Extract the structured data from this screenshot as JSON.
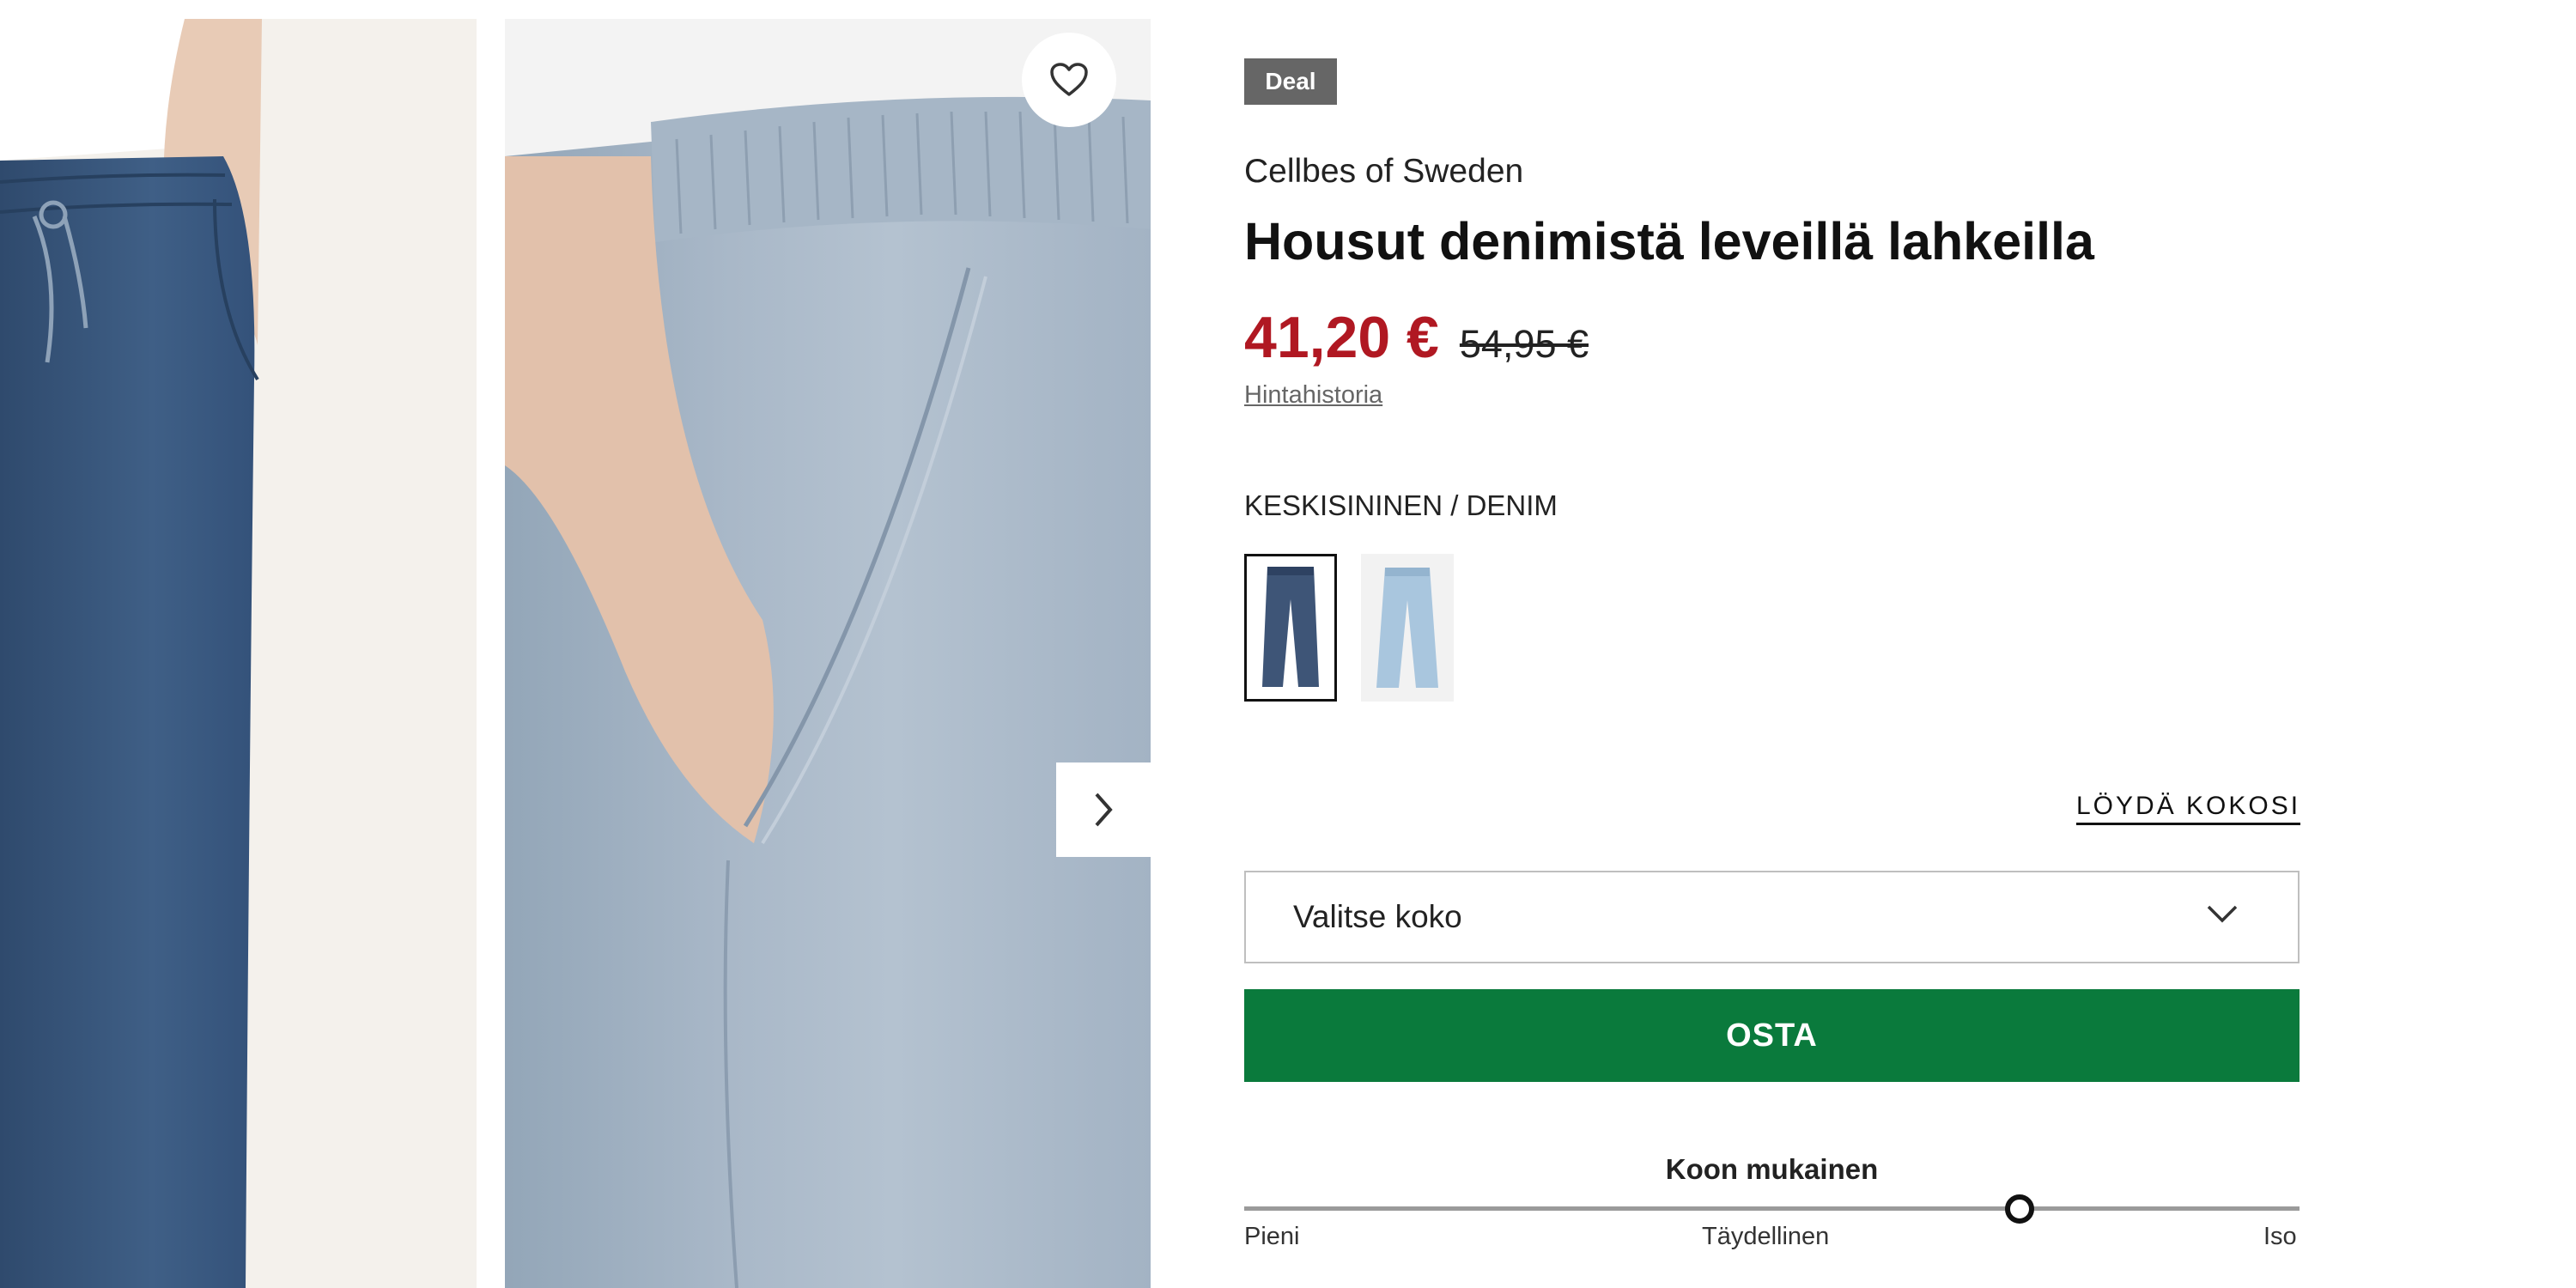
{
  "product": {
    "badge": "Deal",
    "brand": "Cellbes of Sweden",
    "title": "Housut denimistä leveillä lahkeilla",
    "price_current": "41,20 €",
    "price_original": "54,95 €",
    "price_history_link": "Hintahistoria",
    "price_color": "#b01822"
  },
  "gallery": {
    "favorite_icon": "heart-icon",
    "next_icon": "chevron-right-icon"
  },
  "color": {
    "selected_label": "KESKISININEN / DENIM",
    "swatches": [
      {
        "name": "keskisininen-denim",
        "color": "#3e5577",
        "selected": true
      },
      {
        "name": "light-denim",
        "color": "#a9c6de",
        "selected": false
      }
    ]
  },
  "size": {
    "find_size_link": "LÖYDÄ KOKOSI",
    "select_placeholder": "Valitse koko",
    "select_icon": "chevron-down-icon"
  },
  "buy": {
    "label": "OSTA",
    "color": "#0a7a3c"
  },
  "fit": {
    "title": "Koon mukainen",
    "labels": [
      "Pieni",
      "Täydellinen",
      "Iso"
    ],
    "indicator_position": 0.735
  }
}
